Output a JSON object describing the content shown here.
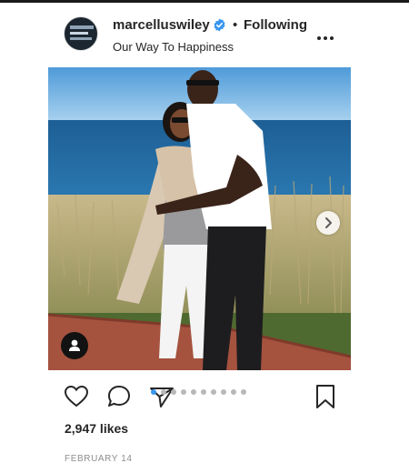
{
  "post": {
    "username": "marcelluswiley",
    "follow_status": "Following",
    "separator": "•",
    "location": "Our Way To Happiness",
    "likes": "2,947 likes",
    "date": "FEBRUARY 14",
    "carousel": {
      "total_slides": 10,
      "active_index": 0
    }
  },
  "colors": {
    "verified_badge": "#3897f0",
    "active_dot": "#3897f0",
    "inactive_dot": "#b8b8b8",
    "text": "#262626",
    "muted_text": "#8e8e8e"
  },
  "icons": {
    "verified": "verified-badge-icon",
    "more": "more-options-icon",
    "like": "heart-icon",
    "comment": "comment-icon",
    "share": "share-icon",
    "save": "bookmark-icon",
    "next": "chevron-right-icon",
    "tag": "user-tag-icon"
  }
}
